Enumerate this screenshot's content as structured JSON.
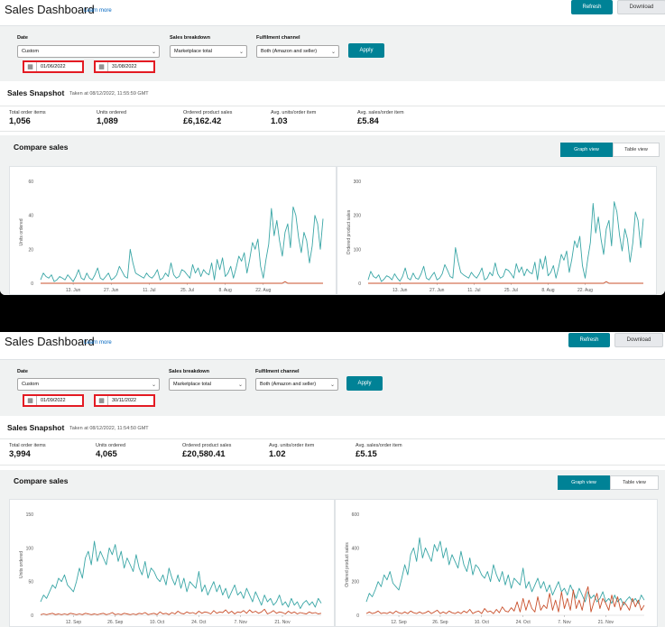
{
  "panels": [
    {
      "header": {
        "title": "Sales Dashboard",
        "learn_more": "Learn more",
        "refresh": "Refresh",
        "download": "Download"
      },
      "filters": {
        "date_label": "Date",
        "date_range": "Custom",
        "breakdown_label": "Sales breakdown",
        "breakdown_value": "Marketplace total",
        "channel_label": "Fulfilment channel",
        "channel_value": "Both (Amazon and seller)",
        "start_date": "01/06/2022",
        "end_date": "31/08/2022",
        "apply": "Apply"
      },
      "snapshot": {
        "title": "Sales Snapshot",
        "taken": "Taken at 08/12/2022, 11:55:59 GMT",
        "metrics": [
          {
            "label": "Total order items",
            "value": "1,056"
          },
          {
            "label": "Units ordered",
            "value": "1,089"
          },
          {
            "label": "Ordered product sales",
            "value": "£6,162.42"
          },
          {
            "label": "Avg. units/order item",
            "value": "1.03"
          },
          {
            "label": "Avg. sales/order item",
            "value": "£5.84"
          }
        ]
      },
      "compare": {
        "title": "Compare sales",
        "graph_view": "Graph view",
        "table_view": "Table view"
      }
    },
    {
      "header": {
        "title": "Sales Dashboard",
        "learn_more": "Learn more",
        "refresh": "Refresh",
        "download": "Download"
      },
      "filters": {
        "date_label": "Date",
        "date_range": "Custom",
        "breakdown_label": "Sales breakdown",
        "breakdown_value": "Marketplace total",
        "channel_label": "Fulfilment channel",
        "channel_value": "Both (Amazon and seller)",
        "start_date": "01/09/2022",
        "end_date": "30/11/2022",
        "apply": "Apply"
      },
      "snapshot": {
        "title": "Sales Snapshot",
        "taken": "Taken at 08/12/2022, 11:54:50 GMT",
        "metrics": [
          {
            "label": "Total order items",
            "value": "3,994"
          },
          {
            "label": "Units ordered",
            "value": "4,065"
          },
          {
            "label": "Ordered product sales",
            "value": "£20,580.41"
          },
          {
            "label": "Avg. units/order item",
            "value": "1.02"
          },
          {
            "label": "Avg. sales/order item",
            "value": "£5.15"
          }
        ]
      },
      "compare": {
        "title": "Compare sales",
        "graph_view": "Graph view",
        "table_view": "Table view"
      }
    }
  ],
  "colors": {
    "teal": "#3aa6a6",
    "red": "#c9502c",
    "accent": "#008296"
  },
  "chart_data": [
    {
      "type": "line",
      "ylabel": "Units ordered",
      "ylim": [
        0,
        60
      ],
      "yticks": [
        0,
        20,
        40,
        60
      ],
      "x_ticks": [
        "13. Jun",
        "27. Jun",
        "11. Jul",
        "25. Jul",
        "8. Aug",
        "22. Aug"
      ],
      "x_tick_index": [
        12,
        26,
        40,
        54,
        68,
        82
      ],
      "series": [
        {
          "color": "#3aa6a6",
          "values": [
            2,
            6,
            4,
            3,
            5,
            1,
            2,
            4,
            3,
            2,
            5,
            3,
            1,
            4,
            8,
            3,
            2,
            6,
            3,
            2,
            5,
            9,
            3,
            2,
            4,
            6,
            2,
            3,
            5,
            10,
            7,
            4,
            3,
            20,
            12,
            6,
            5,
            4,
            3,
            6,
            4,
            3,
            5,
            8,
            2,
            3,
            6,
            4,
            12,
            5,
            3,
            4,
            8,
            7,
            5,
            3,
            11,
            6,
            9,
            4,
            8,
            6,
            5,
            12,
            2,
            14,
            8,
            15,
            4,
            6,
            10,
            3,
            9,
            16,
            13,
            18,
            6,
            14,
            24,
            20,
            26,
            10,
            3,
            14,
            23,
            44,
            28,
            37,
            25,
            16,
            30,
            35,
            21,
            45,
            40,
            27,
            18,
            30,
            25,
            12,
            22,
            40,
            35,
            20,
            38
          ]
        },
        {
          "color": "#c9502c",
          "values": [
            0,
            0,
            0,
            0,
            0,
            0,
            0,
            0,
            0,
            0,
            0,
            0,
            0,
            0,
            0,
            0,
            0,
            0,
            0,
            0,
            0,
            0,
            0,
            0,
            0,
            0,
            0,
            0,
            0,
            0,
            0,
            0,
            0,
            0,
            0,
            0,
            0,
            0,
            0,
            0,
            0,
            0,
            0,
            0,
            0,
            0,
            0,
            0,
            0,
            0,
            0,
            0,
            0,
            0,
            0,
            0,
            0,
            0,
            0,
            0,
            0,
            0,
            0,
            0,
            0,
            0,
            0,
            0,
            0,
            0,
            0,
            0,
            0,
            0,
            0,
            0,
            0,
            0,
            0,
            0,
            0,
            0,
            0,
            0,
            0,
            0,
            0,
            0,
            0,
            0,
            1,
            0,
            0,
            0,
            0,
            0,
            0,
            0,
            0,
            0,
            0,
            0,
            0,
            0,
            0
          ]
        }
      ]
    },
    {
      "type": "line",
      "ylabel": "Ordered product sales",
      "ylim": [
        0,
        300
      ],
      "yticks": [
        0,
        100,
        200,
        300
      ],
      "x_ticks": [
        "13. Jun",
        "27. Jun",
        "11. Jul",
        "25. Jul",
        "8. Aug",
        "22. Aug"
      ],
      "x_tick_index": [
        12,
        26,
        40,
        54,
        68,
        82
      ],
      "series": [
        {
          "color": "#3aa6a6",
          "values": [
            10,
            35,
            20,
            15,
            25,
            5,
            12,
            22,
            18,
            10,
            28,
            15,
            6,
            20,
            45,
            15,
            10,
            30,
            15,
            12,
            28,
            50,
            15,
            10,
            22,
            32,
            10,
            15,
            28,
            55,
            38,
            20,
            15,
            105,
            65,
            32,
            25,
            20,
            15,
            32,
            22,
            15,
            28,
            45,
            10,
            15,
            32,
            22,
            60,
            28,
            15,
            20,
            42,
            38,
            28,
            15,
            58,
            32,
            48,
            22,
            42,
            32,
            28,
            62,
            10,
            72,
            42,
            80,
            22,
            32,
            52,
            15,
            48,
            85,
            68,
            95,
            32,
            72,
            125,
            105,
            138,
            52,
            15,
            72,
            120,
            235,
            148,
            195,
            130,
            85,
            160,
            185,
            110,
            240,
            210,
            142,
            95,
            160,
            130,
            62,
            118,
            210,
            185,
            105,
            190
          ]
        },
        {
          "color": "#c9502c",
          "values": [
            0,
            0,
            0,
            0,
            0,
            0,
            0,
            0,
            0,
            0,
            0,
            0,
            0,
            0,
            0,
            0,
            0,
            0,
            0,
            0,
            0,
            0,
            0,
            0,
            0,
            0,
            0,
            0,
            0,
            0,
            0,
            0,
            0,
            0,
            0,
            0,
            0,
            0,
            0,
            0,
            0,
            0,
            0,
            0,
            0,
            0,
            0,
            0,
            0,
            0,
            0,
            0,
            0,
            0,
            0,
            0,
            0,
            0,
            0,
            0,
            0,
            0,
            0,
            0,
            0,
            0,
            0,
            0,
            0,
            0,
            0,
            0,
            0,
            0,
            0,
            0,
            0,
            0,
            0,
            0,
            0,
            0,
            0,
            0,
            0,
            0,
            0,
            0,
            0,
            0,
            5,
            0,
            0,
            0,
            0,
            0,
            0,
            0,
            0,
            0,
            0,
            0,
            0,
            0,
            0
          ]
        }
      ]
    },
    {
      "type": "line",
      "ylabel": "Units ordered",
      "ylim": [
        0,
        150
      ],
      "yticks": [
        0,
        50,
        100,
        150
      ],
      "x_ticks": [
        "12. Sep",
        "26. Sep",
        "10. Oct",
        "24. Oct",
        "7. Nov",
        "21. Nov"
      ],
      "x_tick_index": [
        11,
        25,
        39,
        53,
        67,
        81
      ],
      "series": [
        {
          "color": "#3aa6a6",
          "values": [
            20,
            30,
            25,
            35,
            45,
            40,
            55,
            50,
            60,
            45,
            40,
            35,
            50,
            70,
            55,
            85,
            95,
            75,
            110,
            80,
            95,
            85,
            75,
            100,
            90,
            105,
            80,
            95,
            70,
            85,
            75,
            65,
            90,
            70,
            60,
            80,
            55,
            70,
            65,
            55,
            50,
            60,
            45,
            70,
            55,
            45,
            60,
            40,
            55,
            35,
            50,
            45,
            40,
            65,
            35,
            45,
            30,
            40,
            50,
            35,
            45,
            30,
            40,
            25,
            35,
            45,
            30,
            35,
            25,
            40,
            30,
            20,
            35,
            25,
            15,
            30,
            20,
            25,
            15,
            20,
            30,
            15,
            20,
            12,
            25,
            15,
            20,
            10,
            18,
            22,
            15,
            20,
            12,
            25,
            18
          ]
        },
        {
          "color": "#c9502c",
          "values": [
            1,
            2,
            1,
            2,
            3,
            1,
            2,
            1,
            2,
            1,
            3,
            2,
            1,
            2,
            1,
            3,
            2,
            1,
            2,
            1,
            2,
            3,
            1,
            2,
            4,
            1,
            2,
            1,
            3,
            2,
            1,
            2,
            1,
            3,
            2,
            4,
            1,
            2,
            3,
            1,
            5,
            2,
            3,
            1,
            4,
            2,
            6,
            3,
            2,
            5,
            3,
            4,
            2,
            6,
            3,
            5,
            4,
            2,
            7,
            3,
            5,
            4,
            8,
            3,
            6,
            2,
            5,
            4,
            7,
            3,
            8,
            4,
            6,
            3,
            5,
            9,
            2,
            4,
            7,
            3,
            5,
            4,
            2,
            6,
            3,
            5,
            2,
            4,
            3,
            2,
            5,
            3,
            4,
            2,
            3
          ]
        }
      ]
    },
    {
      "type": "line",
      "ylabel": "Ordered product sales",
      "ylim": [
        0,
        600
      ],
      "yticks": [
        0,
        200,
        400,
        600
      ],
      "x_ticks": [
        "12. Sep",
        "26. Sep",
        "10. Oct",
        "24. Oct",
        "7. Nov",
        "21. Nov"
      ],
      "x_tick_index": [
        11,
        25,
        39,
        53,
        67,
        81
      ],
      "series": [
        {
          "color": "#3aa6a6",
          "values": [
            80,
            130,
            110,
            150,
            200,
            170,
            240,
            210,
            260,
            190,
            170,
            150,
            220,
            300,
            240,
            360,
            400,
            320,
            460,
            340,
            400,
            360,
            320,
            420,
            380,
            440,
            340,
            400,
            300,
            360,
            320,
            280,
            380,
            300,
            260,
            340,
            240,
            300,
            280,
            240,
            220,
            260,
            200,
            300,
            240,
            200,
            260,
            180,
            240,
            160,
            220,
            200,
            180,
            280,
            160,
            200,
            140,
            180,
            220,
            160,
            200,
            140,
            180,
            120,
            160,
            200,
            140,
            160,
            120,
            180,
            140,
            100,
            160,
            120,
            80,
            140,
            100,
            120,
            80,
            100,
            140,
            80,
            100,
            70,
            120,
            80,
            100,
            60,
            90,
            110,
            80,
            100,
            70,
            120,
            90
          ]
        },
        {
          "color": "#c9502c",
          "values": [
            10,
            20,
            10,
            15,
            25,
            10,
            15,
            10,
            20,
            10,
            25,
            15,
            10,
            20,
            10,
            25,
            15,
            10,
            20,
            10,
            15,
            25,
            10,
            20,
            30,
            10,
            20,
            10,
            25,
            15,
            10,
            20,
            10,
            25,
            15,
            35,
            10,
            20,
            25,
            10,
            40,
            20,
            25,
            10,
            35,
            15,
            50,
            25,
            20,
            45,
            25,
            80,
            20,
            100,
            30,
            90,
            40,
            20,
            110,
            30,
            60,
            40,
            130,
            30,
            90,
            20,
            140,
            40,
            100,
            30,
            150,
            40,
            90,
            30,
            120,
            170,
            20,
            80,
            130,
            40,
            100,
            70,
            30,
            120,
            50,
            110,
            30,
            80,
            60,
            30,
            100,
            50,
            90,
            30,
            60
          ]
        }
      ]
    }
  ]
}
